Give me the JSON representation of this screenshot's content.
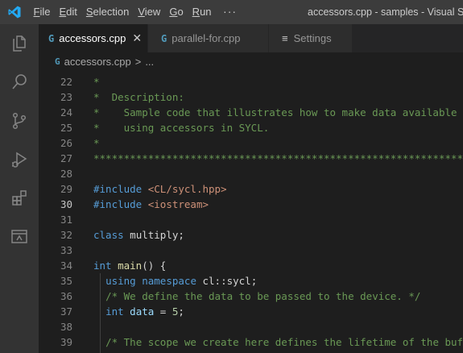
{
  "menu": [
    "File",
    "Edit",
    "Selection",
    "View",
    "Go",
    "Run"
  ],
  "menu_underline": [
    "F",
    "E",
    "S",
    "V",
    "G",
    "R"
  ],
  "menu_more": "···",
  "window_title": "accessors.cpp - samples - Visual Studio Code",
  "tabs": [
    {
      "icon": "G",
      "label": "accessors.cpp",
      "close": "✕"
    },
    {
      "icon": "G",
      "label": "parallel-for.cpp"
    },
    {
      "icon": "≡",
      "label": "Settings"
    }
  ],
  "breadcrumb": {
    "icon": "G",
    "file": "accessors.cpp",
    "sep": ">",
    "rest": "..."
  },
  "line_numbers": [
    "22",
    "23",
    "24",
    "25",
    "26",
    "27",
    "28",
    "29",
    "30",
    "31",
    "32",
    "33",
    "34",
    "35",
    "36",
    "37",
    "38",
    "39"
  ],
  "current_line": "30",
  "code": {
    "l22": "*",
    "l23": "*  Description:",
    "l24": "*    Sample code that illustrates how to make data available",
    "l25": "*    using accessors in SYCL.",
    "l26": "*",
    "l27": "**********************************************************************",
    "l29_pp": "#include",
    "l29_str": "<CL/sycl.hpp>",
    "l30_pp": "#include",
    "l30_str": "<iostream>",
    "l32_kw": "class",
    "l32_rest": " multiply;",
    "l34_kw": "int",
    "l34_fn": "main",
    "l34_rest": "() {",
    "l35_kw1": "using",
    "l35_kw2": "namespace",
    "l35_rest": " cl::sycl;",
    "l36": "/* We define the data to be passed to the device. */",
    "l37_kw": "int",
    "l37_id": "data",
    "l37_op": " = ",
    "l37_num": "5",
    "l37_end": ";",
    "l39": "/* The scope we create here defines the lifetime of the buffer"
  },
  "colors": {
    "titlebar": "#3c3c3c",
    "activitybar": "#333333",
    "editor_bg": "#1e1e1e",
    "comment": "#6a9955",
    "keyword": "#569cd6",
    "string": "#ce9178",
    "function": "#dcdcaa",
    "number": "#b5cea8",
    "variable": "#9cdcfe",
    "accent_logo": "#23a9f2"
  },
  "icons": [
    "vscode-logo-icon",
    "explorer-icon",
    "search-icon",
    "source-control-icon",
    "run-debug-icon",
    "extensions-icon",
    "remote-explorer-icon"
  ]
}
